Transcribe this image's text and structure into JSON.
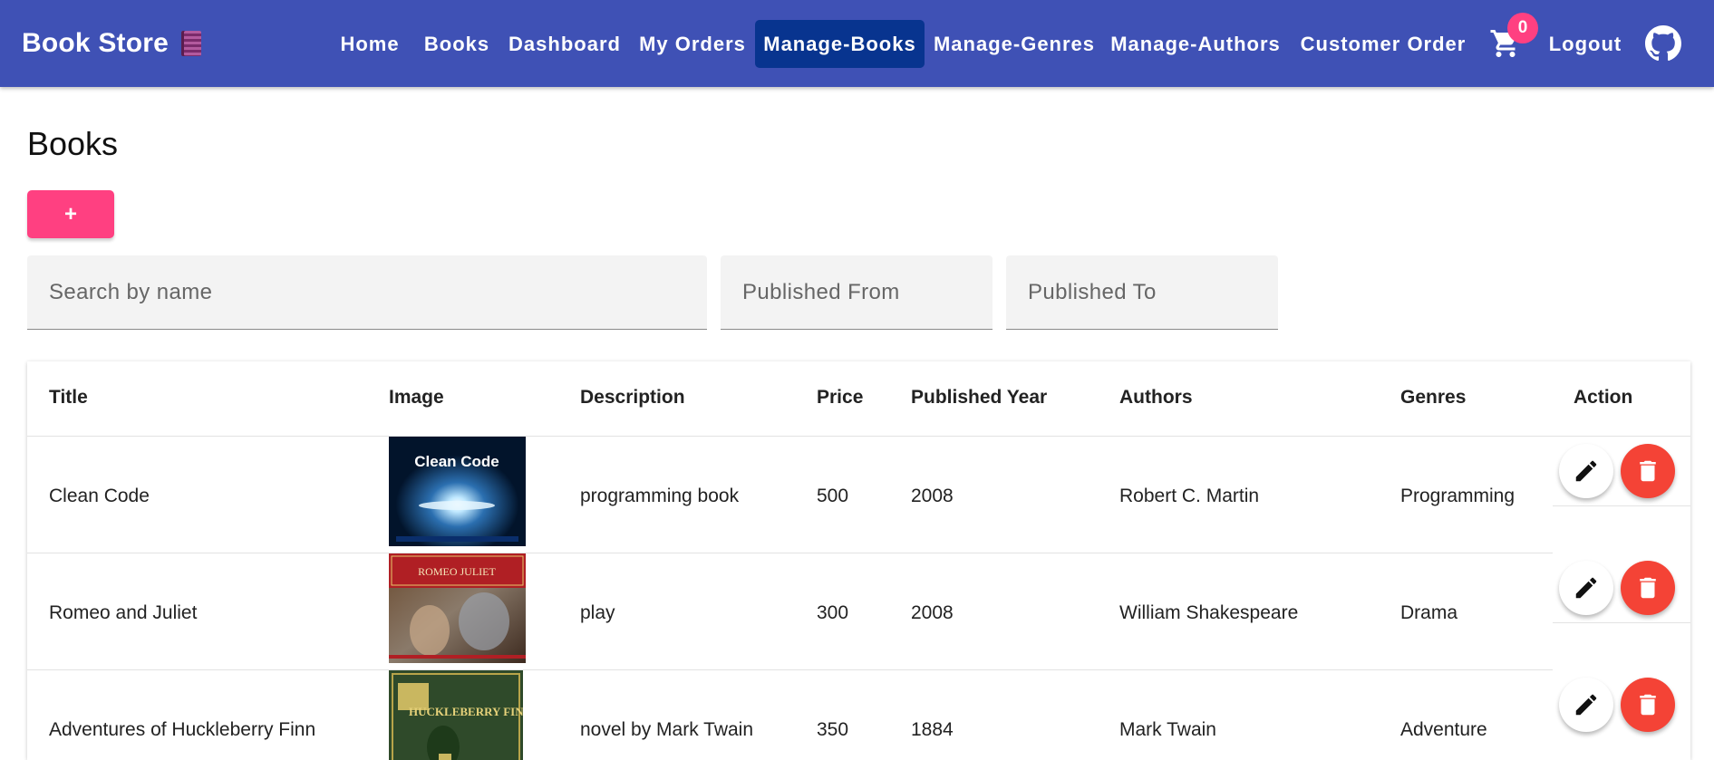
{
  "navbar": {
    "brand": "Book Store",
    "links": [
      "Home",
      "Books",
      "Dashboard",
      "My Orders",
      "Manage-Books",
      "Manage-Genres",
      "Manage-Authors",
      "Customer Order"
    ],
    "active_link": "Manage-Books",
    "cart_count": "0",
    "logout": "Logout",
    "accent_color": "#3f51b5",
    "active_color": "#08348f"
  },
  "page": {
    "title": "Books",
    "add_button": "+",
    "search_placeholder": "Search by name",
    "published_from_placeholder": "Published From",
    "published_to_placeholder": "Published To"
  },
  "table": {
    "headers": [
      "Title",
      "Image",
      "Description",
      "Price",
      "Published Year",
      "Authors",
      "Genres",
      "Action"
    ],
    "rows": [
      {
        "title": "Clean Code",
        "description": "programming book",
        "price": "500",
        "year": "2008",
        "authors": "Robert C. Martin",
        "genres": "Programming",
        "cover_title": "Clean Code"
      },
      {
        "title": "Romeo and Juliet",
        "description": "play",
        "price": "300",
        "year": "2008",
        "authors": "William Shakespeare",
        "genres": "Drama",
        "cover_title": "ROMEO JULIET"
      },
      {
        "title": "Adventures of Huckleberry Finn",
        "description": "novel by Mark Twain",
        "price": "350",
        "year": "1884",
        "authors": "Mark Twain",
        "genres": "Adventure",
        "cover_title": "HUCKLEBERRY FINN"
      }
    ]
  },
  "colors": {
    "pink": "#ff4081",
    "delete_red": "#f44336"
  },
  "icons": [
    "book-icon",
    "cart-icon",
    "github-icon",
    "edit-icon",
    "delete-icon"
  ]
}
